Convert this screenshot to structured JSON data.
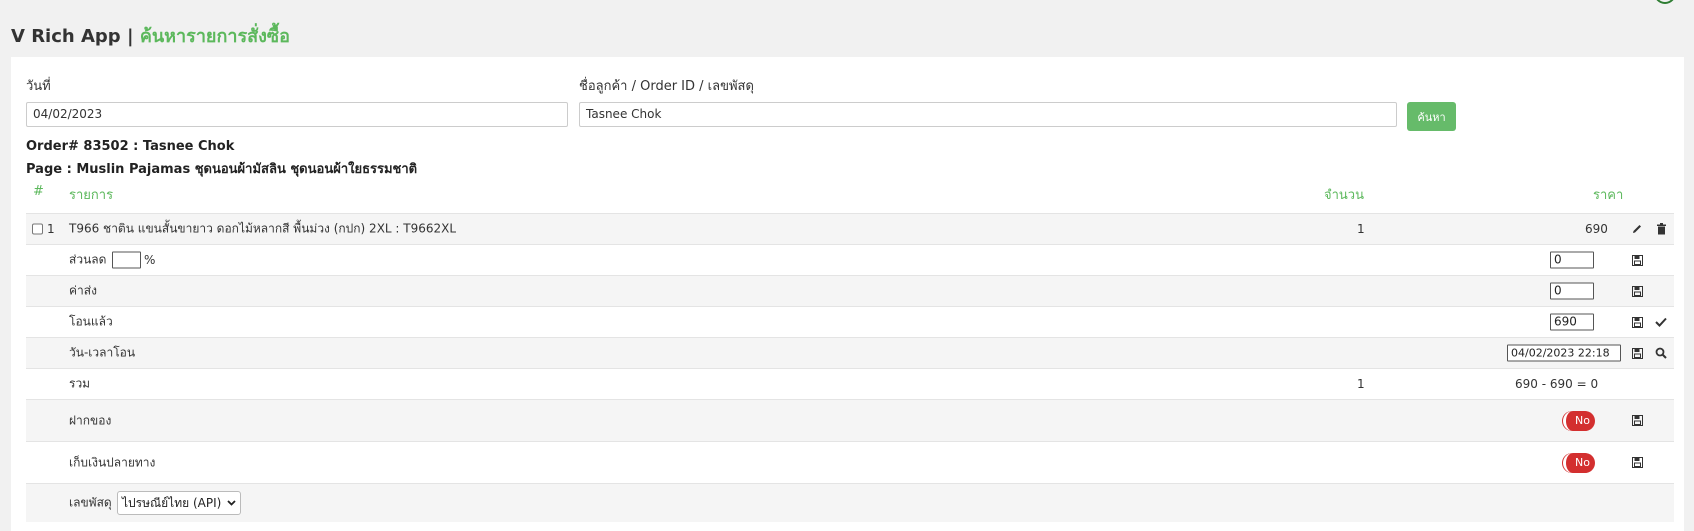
{
  "app": {
    "name": "V Rich App",
    "separator": "|",
    "page_title": "ค้นหารายการสั่งซื้อ"
  },
  "search": {
    "date_label": "วันที่",
    "date_value": "04/02/2023",
    "query_label": "ชื่อลูกค้า / Order ID / เลขพัสดุ",
    "query_value": "Tasnee Chok",
    "search_button": "ค้นหา"
  },
  "order": {
    "order_line": "Order# 83502 : Tasnee Chok",
    "page_line": "Page : Muslin Pajamas ชุดนอนผ้ามัสลิน ชุดนอนผ้าใยธรรมชาติ"
  },
  "table": {
    "headers": {
      "num": "#",
      "item": "รายการ",
      "qty": "จำนวน",
      "price": "ราคา"
    },
    "item": {
      "index": "1",
      "name": "T966 ชาติน แขนสั้นขายาว ดอกไม้หลากสี พื้นม่วง (กปก) 2XL : T9662XL",
      "qty": "1",
      "price": "690"
    },
    "discount": {
      "label": "ส่วนลด",
      "percent_value": "",
      "percent_sign": "%",
      "amount": "0"
    },
    "shipping": {
      "label": "ค่าส่ง",
      "amount": "0"
    },
    "paid": {
      "label": "โอนแล้ว",
      "amount": "690"
    },
    "transfer_time": {
      "label": "วัน-เวลาโอน",
      "value": "04/02/2023 22:18"
    },
    "total": {
      "label": "รวม",
      "qty": "1",
      "formula": "690 - 690 = 0"
    },
    "deposit": {
      "label": "ฝากของ",
      "toggle": "No"
    },
    "cod": {
      "label": "เก็บเงินปลายทาง",
      "toggle": "No"
    },
    "tracking": {
      "label": "เลขพัสดุ",
      "carrier": "ไปรษณีย์ไทย (API)"
    }
  },
  "icons": {
    "edit": "pencil-icon",
    "delete": "trash-icon",
    "save": "floppy-disk-icon",
    "check": "checkmark-icon",
    "search": "magnifier-icon",
    "dropdown": "chevron-down-icon"
  },
  "colors": {
    "accent_green": "#5cb85c",
    "button_green": "#66bb6a",
    "toggle_red": "#d32f2f"
  }
}
